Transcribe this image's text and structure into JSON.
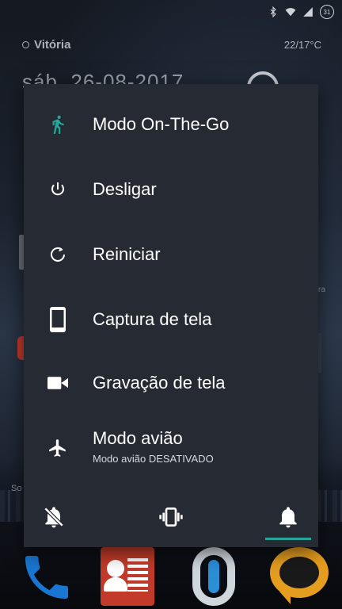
{
  "home": {
    "location": "Vitória",
    "temperature": "22/17°C",
    "date": "sáb, 26-08-2017",
    "peek_text_right": "ra",
    "peek_text_left": "So",
    "battery_level": "31"
  },
  "power_menu": {
    "items": [
      {
        "label": "Modo On-The-Go",
        "icon": "walking-person-icon",
        "icon_color": "#26a69a"
      },
      {
        "label": "Desligar",
        "icon": "power-icon"
      },
      {
        "label": "Reiniciar",
        "icon": "restart-icon"
      },
      {
        "label": "Captura de tela",
        "icon": "phone-screenshot-icon"
      },
      {
        "label": "Gravação de tela",
        "icon": "video-camera-icon"
      },
      {
        "label": "Modo avião",
        "sublabel": "Modo avião DESATIVADO",
        "icon": "airplane-icon"
      }
    ],
    "sound_modes": [
      {
        "name": "silent",
        "icon": "bell-off-icon"
      },
      {
        "name": "vibrate",
        "icon": "vibrate-icon"
      },
      {
        "name": "sound",
        "icon": "bell-icon",
        "selected": true
      }
    ],
    "accent_color": "#26a69a",
    "background_color": "#262a33"
  },
  "dock": {
    "apps": [
      "phone-app",
      "contacts-app",
      "messenger-app",
      "chat-app"
    ]
  }
}
